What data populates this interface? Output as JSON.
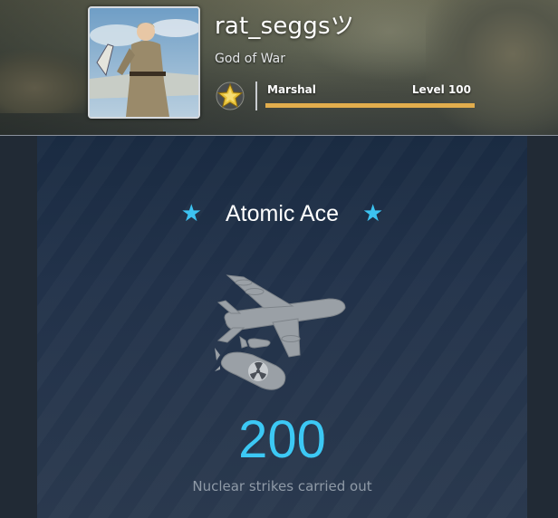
{
  "profile": {
    "username": "rat_seggsツ",
    "title": "God of War",
    "rank": "Marshal",
    "level_label": "Level 100",
    "xp_progress": 1.0
  },
  "award": {
    "name": "Atomic Ace",
    "count": "200",
    "description": "Nuclear strikes carried out"
  },
  "icons": {
    "rank_badge": "gold-star-icon",
    "award_left_star": "star-icon",
    "award_right_star": "star-icon",
    "award_image": "bomber-nuke-icon"
  },
  "colors": {
    "accent": "#3cc8f4",
    "xp_bar": "#e2ad4d",
    "card_bg": "#22324a"
  }
}
